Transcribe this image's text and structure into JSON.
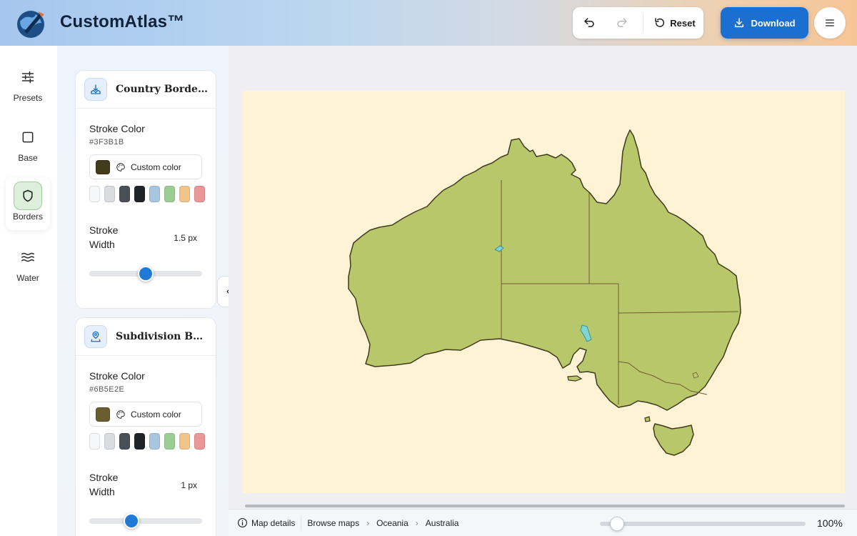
{
  "app": {
    "title": "CustomAtlas™"
  },
  "toolbar": {
    "reset_label": "Reset",
    "download_label": "Download"
  },
  "rail": {
    "items": [
      {
        "label": "Presets",
        "icon": "sliders-icon",
        "active": false
      },
      {
        "label": "Base",
        "icon": "square-icon",
        "active": false
      },
      {
        "label": "Borders",
        "icon": "shield-icon",
        "active": true
      },
      {
        "label": "Water",
        "icon": "waves-icon",
        "active": false
      }
    ]
  },
  "panel": {
    "country_borders": {
      "title": "Country Borders",
      "stroke_color_label": "Stroke Color",
      "stroke_color_hex": "#3F3B1B",
      "custom_color_label": "Custom color",
      "stroke_width_label": "Stroke Width",
      "stroke_width_value": "1.5 px",
      "slider_fraction": 0.5
    },
    "subdivision_borders": {
      "title": "Subdivision Borders",
      "stroke_color_label": "Stroke Color",
      "stroke_color_hex": "#6B5E2E",
      "custom_color_label": "Custom color",
      "stroke_width_label": "Stroke Width",
      "stroke_width_value": "1 px",
      "slider_fraction": 0.35
    },
    "swatch_colors": [
      "#f6f7f9",
      "#dadcdf",
      "#4a4f55",
      "#202327",
      "#a8c7df",
      "#9bcd94",
      "#f2c48a",
      "#ea9797"
    ]
  },
  "map": {
    "background_color": "#fff3d6",
    "land_color": "#b9c76b",
    "lake_color": "#7fd6d4"
  },
  "footer": {
    "map_details_label": "Map details",
    "breadcrumbs": [
      "Browse maps",
      "Oceania",
      "Australia"
    ],
    "zoom_label": "100%"
  }
}
